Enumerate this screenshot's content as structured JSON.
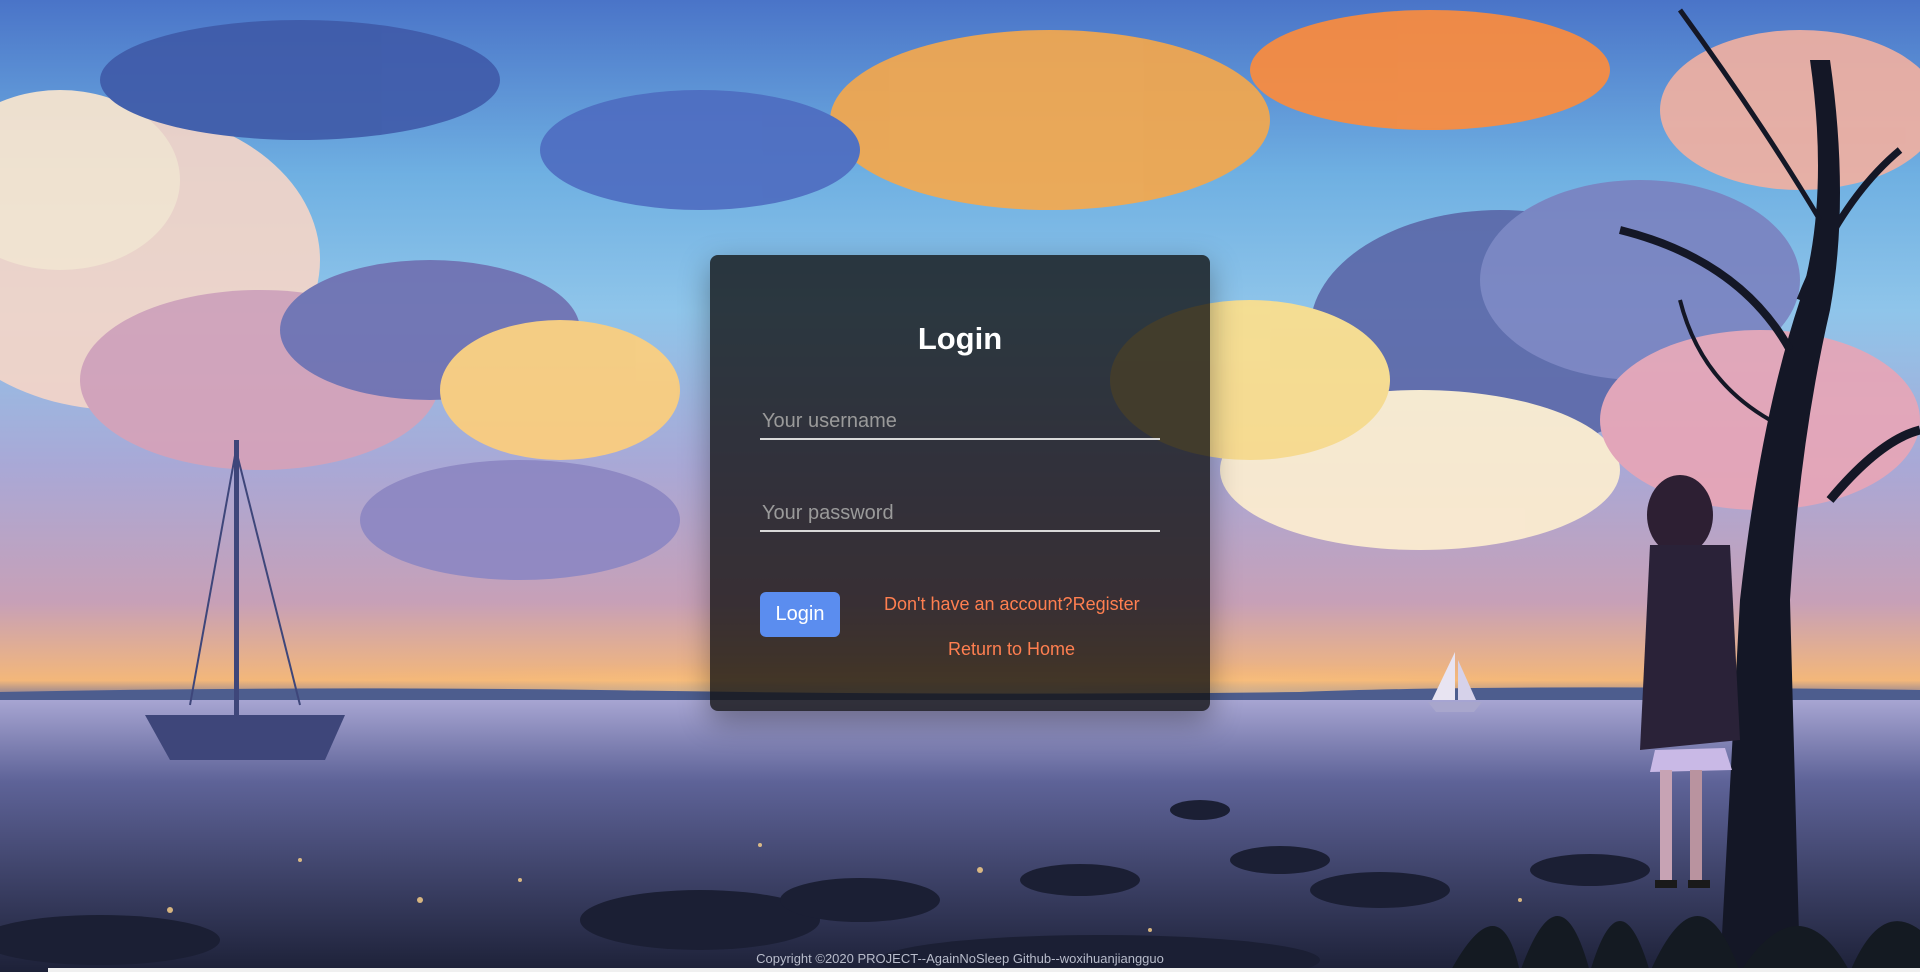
{
  "login_form": {
    "title": "Login",
    "username_placeholder": "Your username",
    "password_placeholder": "Your password",
    "login_button": "Login",
    "register_link": "Don't have an account?Register",
    "home_link": "Return to Home"
  },
  "footer": {
    "copyright": "Copyright ©2020 PROJECT--AgainNoSleep Github--woxihuanjiangguo"
  },
  "colors": {
    "card_background": "#0f0f0f",
    "button": "#5b8def",
    "link": "#ff7f50"
  }
}
